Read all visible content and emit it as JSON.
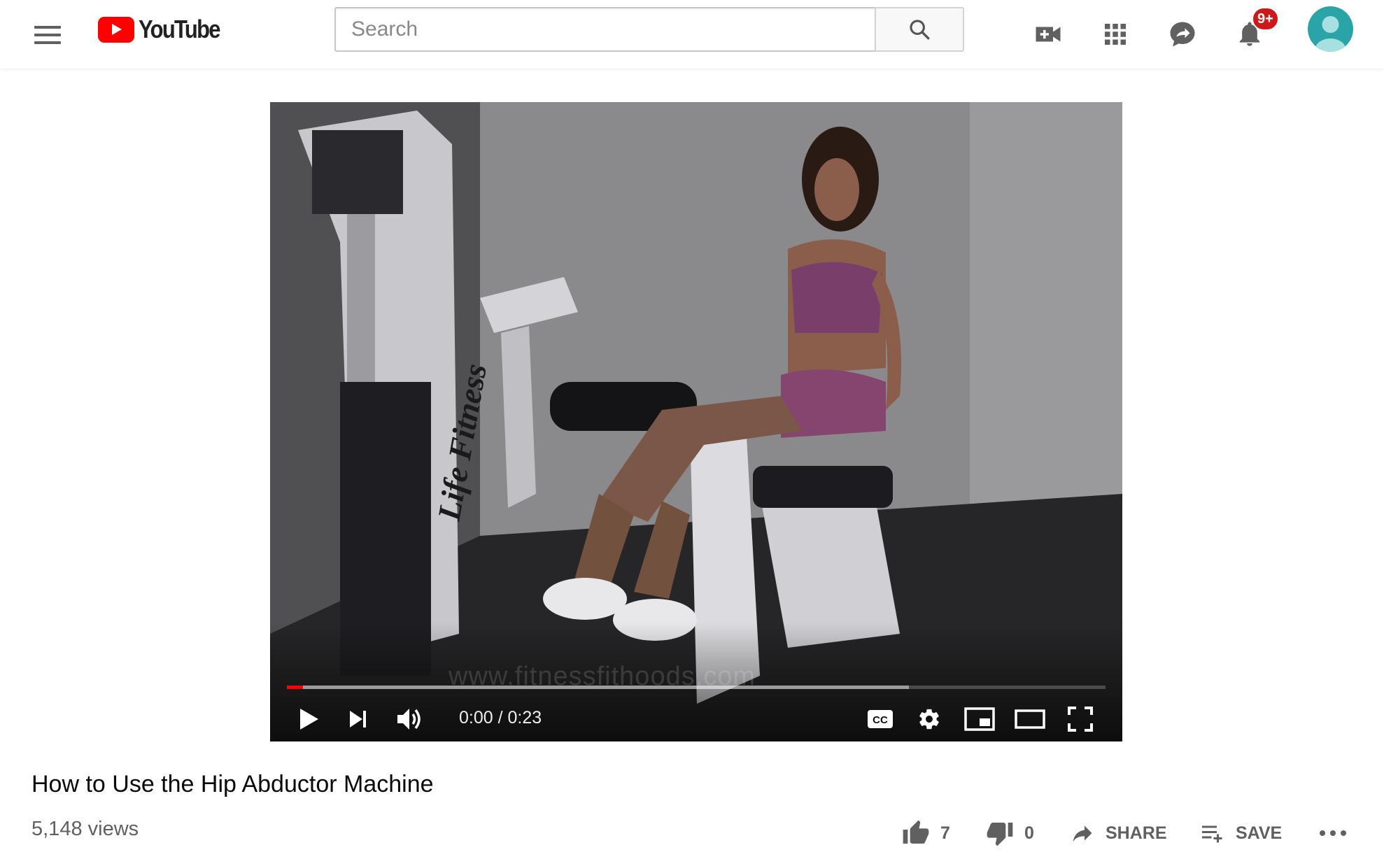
{
  "masthead": {
    "logo_text": "YouTube",
    "search_placeholder": "Search",
    "notification_count": "9+"
  },
  "player": {
    "watermark": "www.fitnessfithoods.com",
    "time_current": "0:00",
    "time_separator": "/",
    "time_total": "0:23",
    "progress_played_fraction": 0.02,
    "progress_loaded_fraction": 0.76
  },
  "video": {
    "title": "How to Use the Hip Abductor Machine",
    "views": "5,148 views",
    "likes": "7",
    "dislikes": "0",
    "share_label": "SHARE",
    "save_label": "SAVE"
  },
  "colors": {
    "brand_red": "#ff0000",
    "badge_red": "#cc1a1a",
    "avatar_teal": "#2ba4a8",
    "icon_gray": "#606060"
  },
  "icons": [
    "menu-icon",
    "youtube-logo-icon",
    "search-icon",
    "create-video-icon",
    "apps-icon",
    "messages-icon",
    "notifications-icon",
    "play-icon",
    "next-icon",
    "volume-icon",
    "captions-icon",
    "settings-icon",
    "miniplayer-icon",
    "theater-icon",
    "fullscreen-icon",
    "like-icon",
    "dislike-icon",
    "share-icon",
    "save-icon",
    "more-icon"
  ]
}
